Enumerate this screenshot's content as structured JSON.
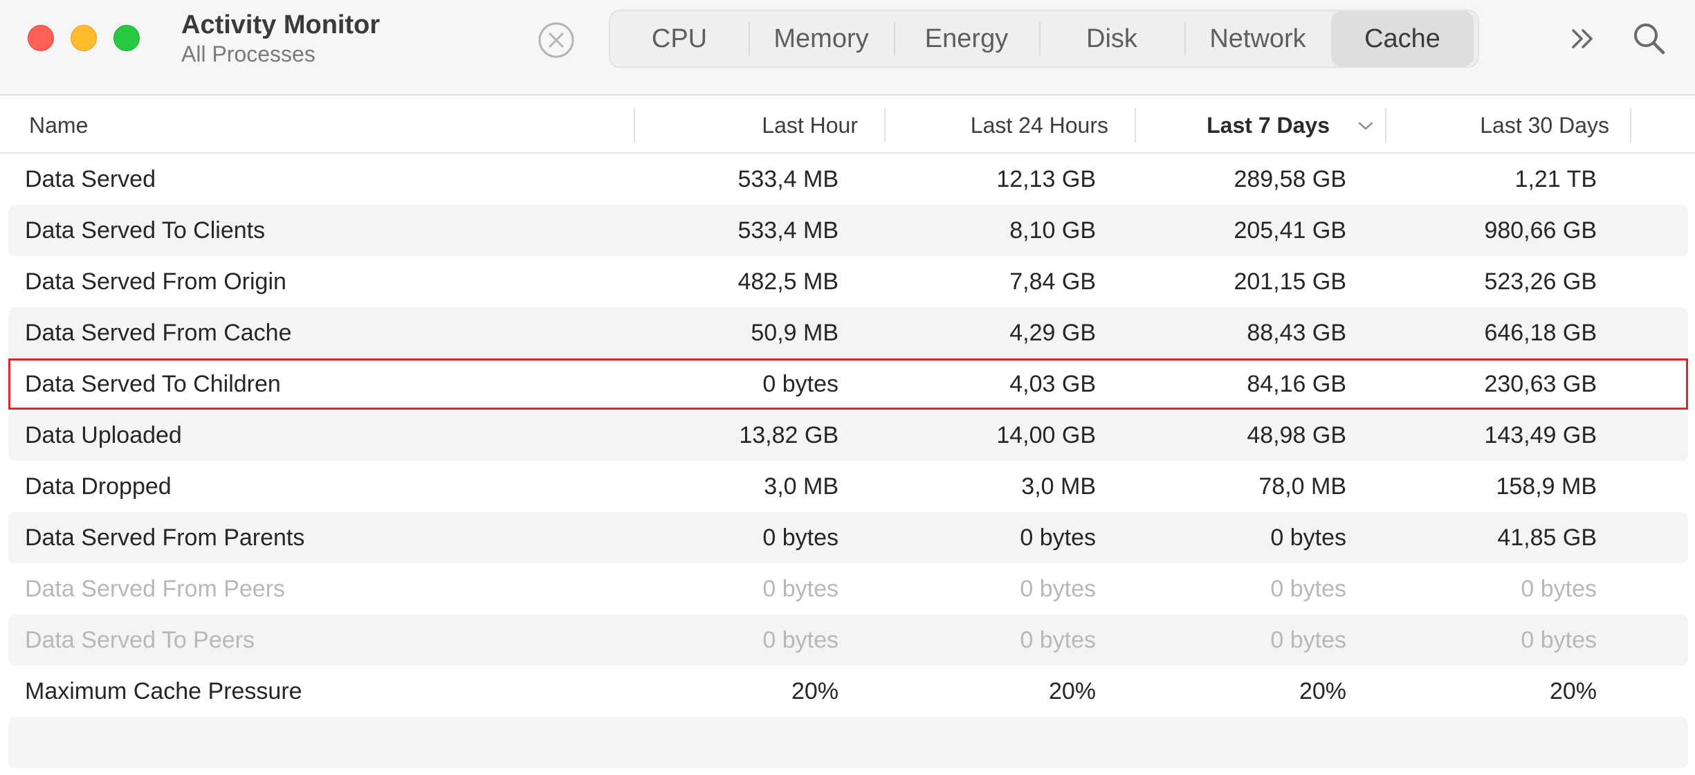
{
  "window": {
    "title": "Activity Monitor",
    "subtitle": "All Processes"
  },
  "tabs": [
    {
      "label": "CPU",
      "active": false
    },
    {
      "label": "Memory",
      "active": false
    },
    {
      "label": "Energy",
      "active": false
    },
    {
      "label": "Disk",
      "active": false
    },
    {
      "label": "Network",
      "active": false
    },
    {
      "label": "Cache",
      "active": true
    }
  ],
  "toolbar": {
    "stop_icon": "stop-process-icon",
    "more_icon": "chevron-double-right-icon",
    "search_icon": "search-icon"
  },
  "columns": {
    "name": "Name",
    "last_hour": "Last Hour",
    "last_24_hours": "Last 24 Hours",
    "last_7_days": "Last 7 Days",
    "last_30_days": "Last 30 Days",
    "sorted_by": "Last 7 Days",
    "sort_icon": "chevron-down-icon"
  },
  "colors": {
    "highlight_outline": "#e0242a",
    "close": "#fe5f57",
    "minimize": "#febc2e",
    "zoom": "#28c840"
  },
  "rows": [
    {
      "name": "Data Served",
      "values": [
        "533,4 MB",
        "12,13 GB",
        "289,58 GB",
        "1,21 TB"
      ]
    },
    {
      "name": "Data Served To Clients",
      "values": [
        "533,4 MB",
        "8,10 GB",
        "205,41 GB",
        "980,66 GB"
      ]
    },
    {
      "name": "Data Served From Origin",
      "values": [
        "482,5 MB",
        "7,84 GB",
        "201,15 GB",
        "523,26 GB"
      ]
    },
    {
      "name": "Data Served From Cache",
      "values": [
        "50,9 MB",
        "4,29 GB",
        "88,43 GB",
        "646,18 GB"
      ]
    },
    {
      "name": "Data Served To Children",
      "values": [
        "0 bytes",
        "4,03 GB",
        "84,16 GB",
        "230,63 GB"
      ],
      "highlighted": true
    },
    {
      "name": "Data Uploaded",
      "values": [
        "13,82 GB",
        "14,00 GB",
        "48,98 GB",
        "143,49 GB"
      ]
    },
    {
      "name": "Data Dropped",
      "values": [
        "3,0 MB",
        "3,0 MB",
        "78,0 MB",
        "158,9 MB"
      ]
    },
    {
      "name": "Data Served From Parents",
      "values": [
        "0 bytes",
        "0 bytes",
        "0 bytes",
        "41,85 GB"
      ]
    },
    {
      "name": "Data Served From Peers",
      "values": [
        "0 bytes",
        "0 bytes",
        "0 bytes",
        "0 bytes"
      ],
      "dimmed": true
    },
    {
      "name": "Data Served To Peers",
      "values": [
        "0 bytes",
        "0 bytes",
        "0 bytes",
        "0 bytes"
      ],
      "dimmed": true
    },
    {
      "name": "Maximum Cache Pressure",
      "values": [
        "20%",
        "20%",
        "20%",
        "20%"
      ]
    },
    {
      "name": "",
      "values": [
        "",
        "",
        "",
        ""
      ]
    }
  ]
}
